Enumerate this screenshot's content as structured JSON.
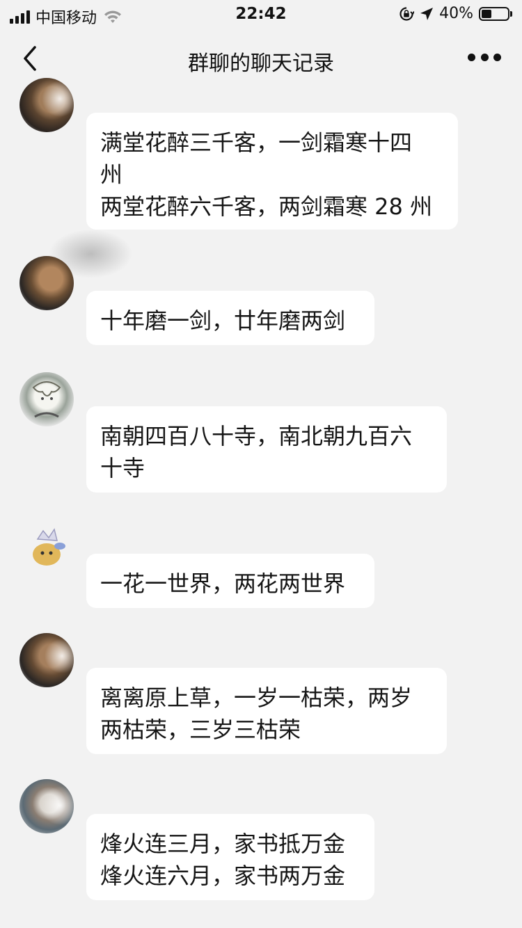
{
  "status_bar": {
    "carrier": "中国移动",
    "time": "22:42",
    "battery": "40%",
    "battery_level": 0.4
  },
  "nav": {
    "title": "群聊的聊天记录",
    "back_icon": "chevron-left-icon",
    "more_icon": "ellipsis-icon"
  },
  "messages": [
    {
      "text": "满堂花醉三千客，一剑霜寒十四\n州\n两堂花醉六千客，两剑霜寒 28 州"
    },
    {
      "text": "十年磨一剑，廿年磨两剑"
    },
    {
      "text": "南朝四百八十寺，南北朝九百六\n十寺"
    },
    {
      "text": "一花一世界，两花两世界"
    },
    {
      "text": "离离原上草，一岁一枯荣，两岁\n两枯荣，三岁三枯荣"
    },
    {
      "text": "烽火连三月，家书抵万金\n烽火连六月，家书两万金"
    }
  ],
  "colors": {
    "background": "#f2f2f2",
    "bubble": "#ffffff",
    "text": "#151515"
  }
}
